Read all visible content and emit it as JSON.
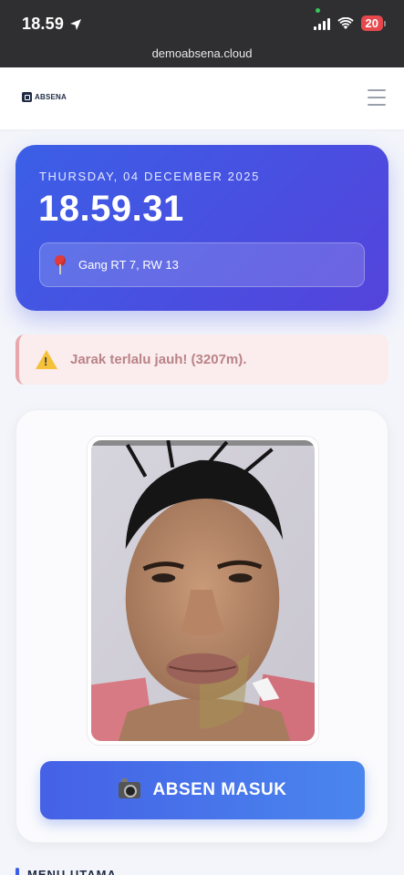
{
  "status_bar": {
    "time": "18.59",
    "battery": "20"
  },
  "browser": {
    "url": "demoabsena.cloud"
  },
  "header": {
    "brand": "ABSENA"
  },
  "time_card": {
    "date": "THURSDAY, 04 DECEMBER 2025",
    "clock": "18.59.31",
    "location": "Gang RT 7, RW 13"
  },
  "alert": {
    "message": "Jarak terlalu jauh! (3207m)."
  },
  "camera": {
    "button_label": "ABSEN MASUK"
  },
  "section": {
    "title": "MENU UTAMA"
  },
  "colors": {
    "primary": "#4a4ee0",
    "warning_bg": "#fbeced",
    "warning_text": "#b98488"
  }
}
